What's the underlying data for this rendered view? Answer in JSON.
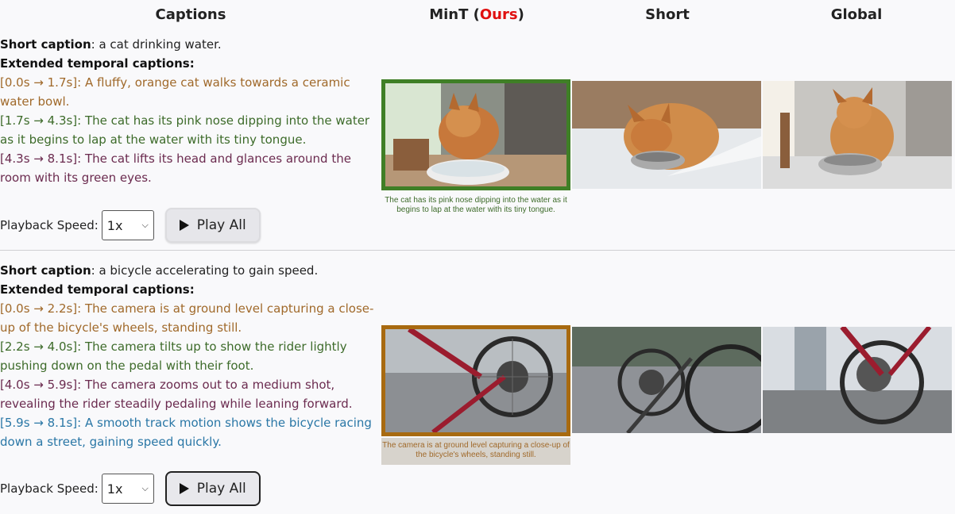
{
  "header": {
    "captions": "Captions",
    "mint": "MinT (",
    "ours": "Ours",
    "mint_close": ")",
    "short": "Short",
    "global": "Global"
  },
  "rows": [
    {
      "short_label": "Short caption",
      "short_text": ": a cat drinking water.",
      "extended_label": "Extended temporal captions:",
      "captions": [
        "[0.0s → 1.7s]: A fluffy, orange cat walks towards a ceramic water bowl.",
        "[1.7s → 4.3s]: The cat has its pink nose dipping into the water as it begins to lap at the water with its tiny tongue.",
        "[4.3s → 8.1s]: The cat lifts its head and glances around the room with its green eyes."
      ],
      "caption_colors": [
        "#a0692a",
        "#3d6b2a",
        "#6b2b4f"
      ],
      "speed_label": "Playback Speed:",
      "speed_value": "1x",
      "play_label": "Play All",
      "ours_subcaption": "The cat has its pink nose dipping into the water as it begins to lap at the water with its tiny tongue.",
      "ours_frame_color": "#3f7f26"
    },
    {
      "short_label": "Short caption",
      "short_text": ": a bicycle accelerating to gain speed.",
      "extended_label": "Extended temporal captions:",
      "captions": [
        "[0.0s → 2.2s]: The camera is at ground level capturing a close-up of the bicycle's wheels, standing still.",
        "[2.2s → 4.0s]: The camera tilts up to show the rider lightly pushing down on the pedal with their foot.",
        "[4.0s → 5.9s]: The camera zooms out to a medium shot, revealing the rider steadily pedaling while leaning forward.",
        "[5.9s → 8.1s]: A smooth track motion shows the bicycle racing down a street, gaining speed quickly."
      ],
      "caption_colors": [
        "#a0692a",
        "#3d6b2a",
        "#6b2b4f",
        "#2a77a6"
      ],
      "speed_label": "Playback Speed:",
      "speed_value": "1x",
      "play_label": "Play All",
      "ours_subcaption": "The camera is at ground level capturing a close-up of the bicycle's wheels, standing still.",
      "ours_frame_color": "#a86a10"
    }
  ]
}
